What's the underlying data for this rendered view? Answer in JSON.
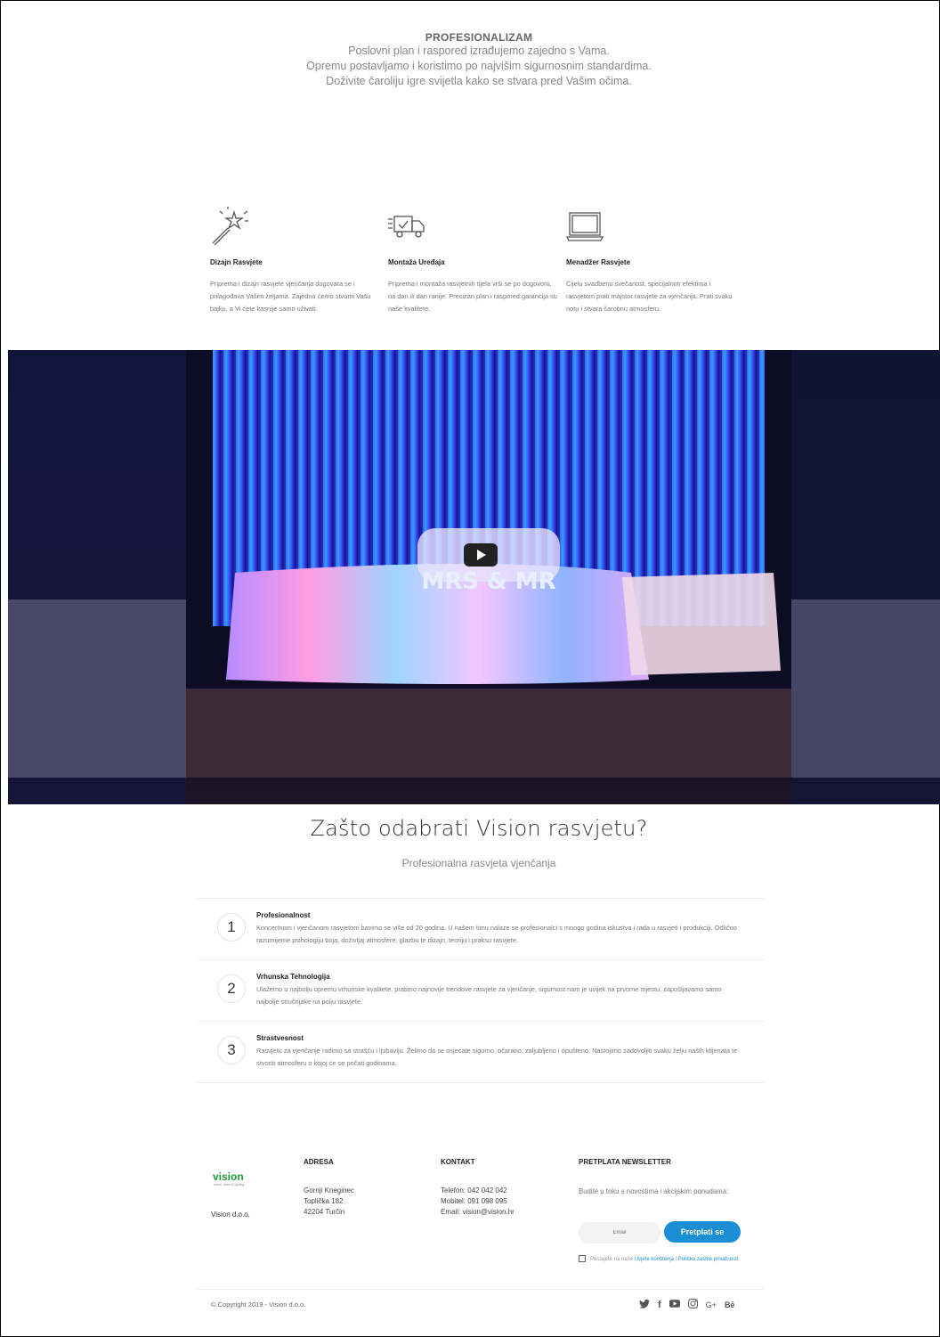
{
  "intro": {
    "title": "PROFESIONALIZAM",
    "line1": "Poslovni plan i raspored izrađujemo zajedno s Vama.",
    "line2": "Opremu postavljamo i koristimo po najvišim sigurnosnim standardima.",
    "line3": "Doživite čaroliju igre svijetla kako se stvara pred Vašim očima."
  },
  "features": [
    {
      "icon": "magic-wand-icon",
      "title": "Dizajn Rasvjete",
      "text": "Priprema i dizajn rasvjete vjenčanja dogovara se i prilagođava Vašim željama. Zajedno ćemo stvoriti Vašu bajku, a Vi ćete kasnije samo uživati."
    },
    {
      "icon": "delivery-truck-icon",
      "title": "Montaža Uređaja",
      "text": "Priprema i montaža rasvjetnih tijela vrši se po dogovoru, na dan ili dan ranije. Precizan plan i raspored garancija su naše kvalitete."
    },
    {
      "icon": "laptop-icon",
      "title": "Menadžer Rasvjete",
      "text": "Cijelu svadbenu svečanost, specijalnim efektima i rasvjetom prati majstor rasvjete za vjenčanja. Prati svaku notu i stvara čarobnu atmosferu."
    }
  ],
  "video": {
    "table_sign": "MRS & MR"
  },
  "why": {
    "title": "Zašto odabrati Vision rasvjetu?",
    "subtitle": "Profesionalna rasvjeta vjenčanja",
    "items": [
      {
        "number": "1",
        "title": "Profesionalnost",
        "text": "Koncertnom i vjenčanom rasvjetom bavimo se više od 20 godina. U našem timu nalaze se profesionalci s mnogo godina iskustva i rada u rasvjeti i produkciji. Odlično razumijeme psihologiju boja, doživljaj atmosfere, glazbu te dizajn, teoriju i praksu rasvjete."
      },
      {
        "number": "2",
        "title": "Vrhunska Tehnologija",
        "text": "Ulažemo u najbolju opremu vrhunske kvalitete, pratimo najnovije trendove rasvjete za vjenčanje, sigurnost nam je uvijek na prvome mjestu, zapošljavamo samo najbolje stručnjake na polju rasvjete."
      },
      {
        "number": "3",
        "title": "Strastvesnost",
        "text": "Rasvjetu za vjenčanje radimo sa strašću i ljubavlju. Želimo da se osjećate sigurno, očarano, zaljubljeno i opušteno. Nastojimo zadovoljiti svaku želju naših klijenata te stvoriti atmosferu o kojoj će se pričati godinama."
      }
    ]
  },
  "footer": {
    "logo_text": "vision",
    "logo_tagline": "event, video & lighting",
    "company": "Vision d.o.o.",
    "address": {
      "title": "ADRESA",
      "line1": "Gornji Kneginec",
      "line2": "Toplička 182",
      "line3": "42204 Turčin"
    },
    "contact": {
      "title": "KONTAKT",
      "phone": "Telefon: 042 042 042",
      "mobile": "Mobitel: 091 098 095",
      "email": "Email: vision@vision.hr"
    },
    "newsletter": {
      "title": "PRETPLATA NEWSLETTER",
      "text": "Budite u toku s novostima i akcijskim ponudama:",
      "email_placeholder": "Email",
      "button": "Pretplati se",
      "agree_prefix": "Pristajete na naše ",
      "terms_link": "Uvjete korištenja",
      "agree_and": " i ",
      "privacy_link": "Politiku zaštite privatnosti",
      "agree_suffix": "."
    },
    "copyright": "© Copyright 2019 - Vision d.o.o.",
    "social": [
      {
        "icon": "twitter-icon",
        "glyph": "🐦"
      },
      {
        "icon": "facebook-icon",
        "glyph": "f"
      },
      {
        "icon": "youtube-icon",
        "glyph": "▶"
      },
      {
        "icon": "instagram-icon",
        "glyph": "◎"
      },
      {
        "icon": "google-plus-icon",
        "glyph": "G+"
      },
      {
        "icon": "behance-icon",
        "glyph": "Bē"
      }
    ]
  },
  "colors": {
    "accent": "#1a8fd6",
    "logo_green": "#1f9a3a"
  }
}
